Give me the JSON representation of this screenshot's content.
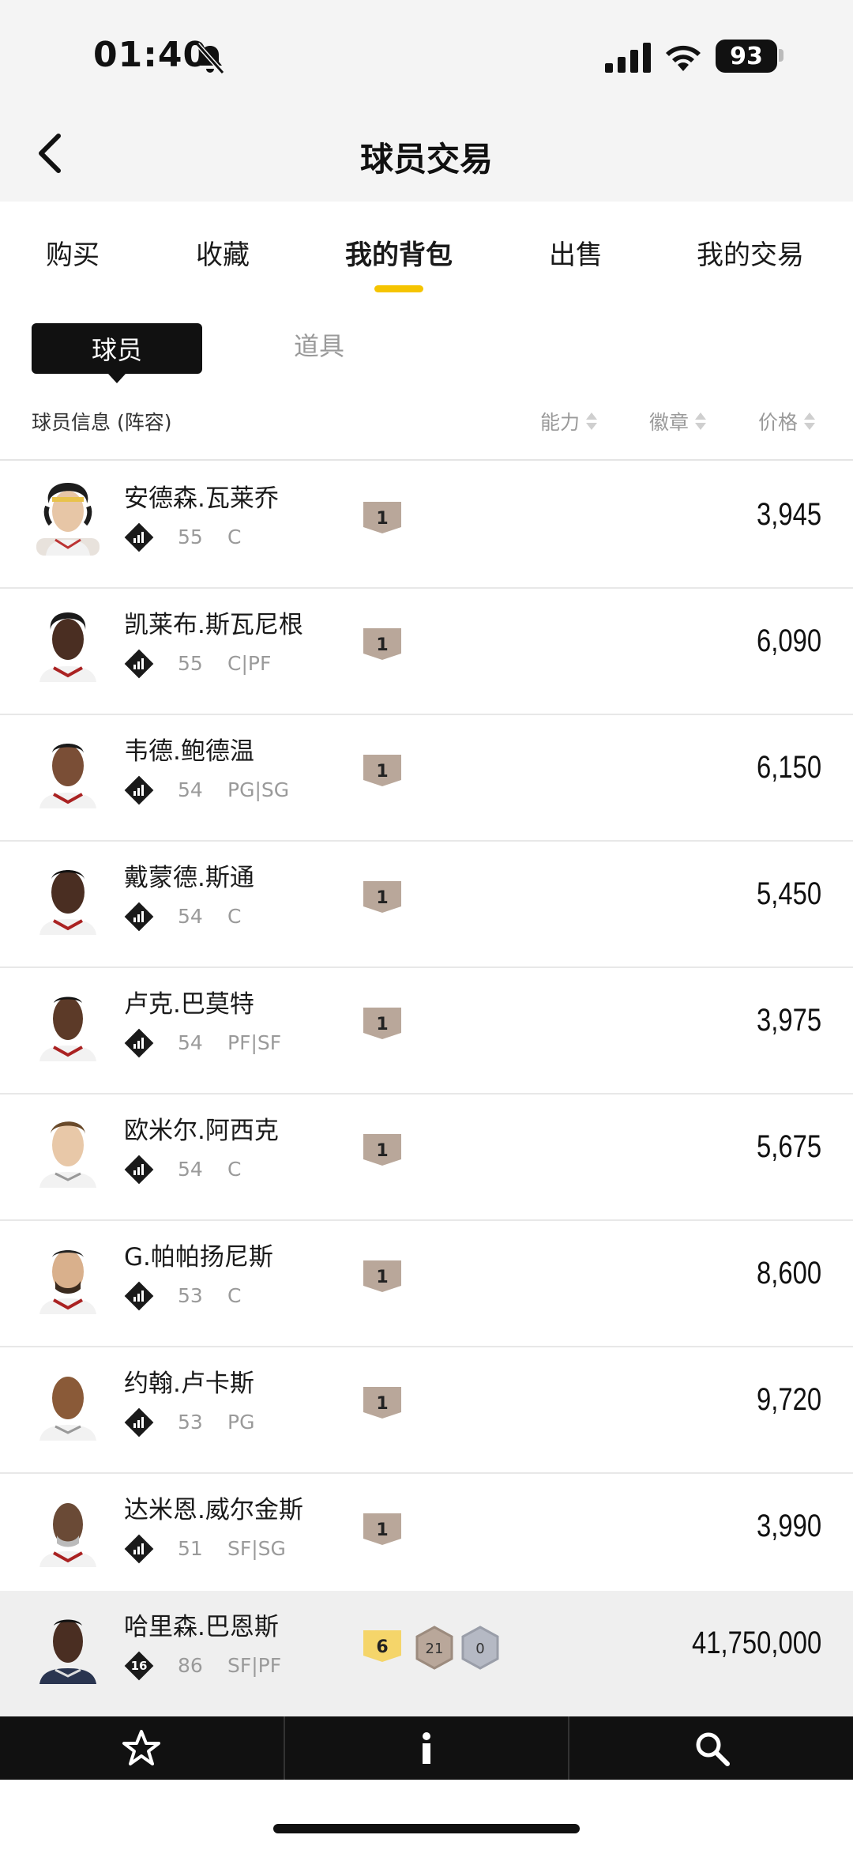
{
  "status_bar": {
    "time": "01:40",
    "battery": "93"
  },
  "nav": {
    "title": "球员交易"
  },
  "tabs": [
    {
      "label": "购买"
    },
    {
      "label": "收藏"
    },
    {
      "label": "我的背包"
    },
    {
      "label": "出售"
    },
    {
      "label": "我的交易"
    }
  ],
  "subtabs": {
    "active": "球员",
    "inactive": "道具"
  },
  "list_header": {
    "info": "球员信息 (阵容)",
    "ability": "能力",
    "badge": "徽章",
    "price": "价格"
  },
  "players": [
    {
      "name": "安德森.瓦莱乔",
      "tier": "",
      "rating": "55",
      "pos": "C",
      "badge": "1",
      "price": "3,945"
    },
    {
      "name": "凯莱布.斯瓦尼根",
      "tier": "",
      "rating": "55",
      "pos": "C|PF",
      "badge": "1",
      "price": "6,090"
    },
    {
      "name": "韦德.鲍德温",
      "tier": "",
      "rating": "54",
      "pos": "PG|SG",
      "badge": "1",
      "price": "6,150"
    },
    {
      "name": "戴蒙德.斯通",
      "tier": "",
      "rating": "54",
      "pos": "C",
      "badge": "1",
      "price": "5,450"
    },
    {
      "name": "卢克.巴莫特",
      "tier": "",
      "rating": "54",
      "pos": "PF|SF",
      "badge": "1",
      "price": "3,975"
    },
    {
      "name": "欧米尔.阿西克",
      "tier": "",
      "rating": "54",
      "pos": "C",
      "badge": "1",
      "price": "5,675"
    },
    {
      "name": "G.帕帕扬尼斯",
      "tier": "",
      "rating": "53",
      "pos": "C",
      "badge": "1",
      "price": "8,600"
    },
    {
      "name": "约翰.卢卡斯",
      "tier": "",
      "rating": "53",
      "pos": "PG",
      "badge": "1",
      "price": "9,720"
    },
    {
      "name": "达米恩.威尔金斯",
      "tier": "",
      "rating": "51",
      "pos": "SF|SG",
      "badge": "1",
      "price": "3,990"
    },
    {
      "name": "哈里森.巴恩斯",
      "tier": "16",
      "rating": "86",
      "pos": "SF|PF",
      "badge": "6",
      "badge2": "21",
      "badge3": "0",
      "price": "41,750,000"
    }
  ],
  "colors": {
    "accent": "#f5c400",
    "badge_bronze": "#b9a79a",
    "badge_gold": "#f5d56a",
    "badge_silver": "#b5b9c4"
  }
}
